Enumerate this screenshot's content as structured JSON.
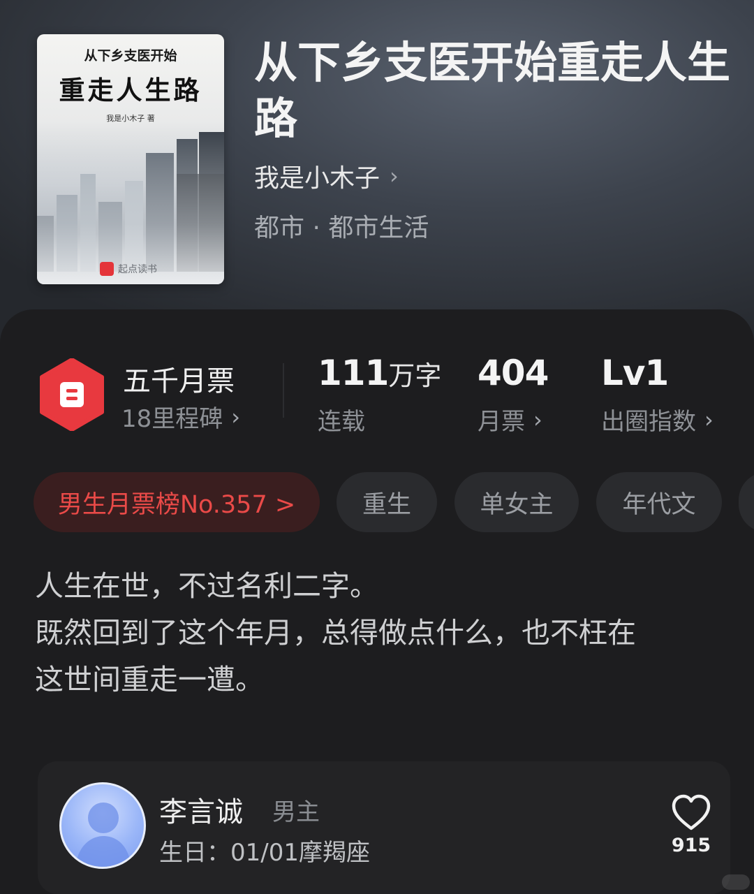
{
  "book": {
    "cover": {
      "subtitle": "从下乡支医开始",
      "title": "重走人生路",
      "author_line": "我是小木子 著",
      "publisher": "起点读书"
    },
    "title": "从下乡支医开始重走人生路",
    "author": "我是小木子",
    "genre": "都市 · 都市生活"
  },
  "stats": {
    "milestone": {
      "title": "五千月票",
      "subtitle": "18里程碑"
    },
    "words": {
      "value": "111",
      "unit": "万字",
      "label": "连载"
    },
    "tickets": {
      "value": "404",
      "label": "月票"
    },
    "level": {
      "value": "Lv1",
      "label": "出圈指数"
    }
  },
  "tags": [
    {
      "label": "男生月票榜No.357 >"
    },
    {
      "label": "重生"
    },
    {
      "label": "单女主"
    },
    {
      "label": "年代文"
    }
  ],
  "intro": {
    "line1": "人生在世，不过名利二字。",
    "line2": "既然回到了这个年月，总得做点什么，也不枉在",
    "line3": "这世间重走一遭。"
  },
  "character": {
    "name": "李言诚",
    "role": "男主",
    "birthday": "生日：01/01摩羯座",
    "likes": "915"
  },
  "colors": {
    "accent_red": "#ea4a48",
    "badge_red": "#e8393f",
    "background": "#1d1d1f"
  },
  "icons": [
    "ticket-badge-icon",
    "chevron-right-icon",
    "heart-icon"
  ]
}
